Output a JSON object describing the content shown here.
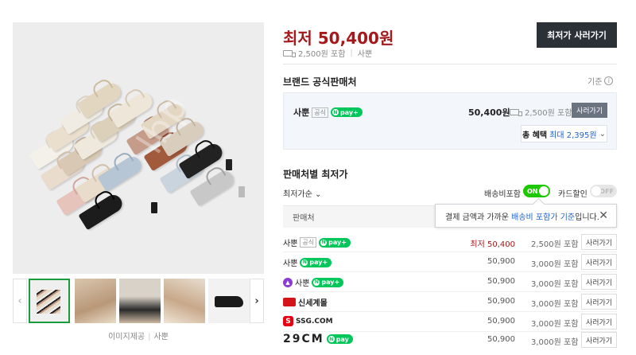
{
  "main_image": {
    "watermark": "lbp"
  },
  "gallery": {
    "prev": "‹",
    "next": "›",
    "caption_label": "이미지제공",
    "caption_sep": "|",
    "caption_source": "사뿐"
  },
  "summary": {
    "price": "최저 50,400원",
    "shipping": "2,500원 포함",
    "separator": "|",
    "store": "사뿐",
    "buy_button": "최저가 사러가기"
  },
  "official": {
    "title": "브랜드 공식판매처",
    "criteria": "기준",
    "seller": "사뿐",
    "badge": "공식",
    "pay_label": "pay+",
    "price": "50,400원",
    "shipping": "2,500원 포함",
    "go_button": "사러가기",
    "benefit_label": "총 혜택",
    "benefit_max": "최대 2,395원"
  },
  "sellers": {
    "title": "판매처별 최저가",
    "sort": "최저가순",
    "toggle1_label": "배송비포함",
    "toggle1_state": "ON",
    "toggle2_label": "카드할인",
    "toggle2_state": "OFF",
    "column_seller": "판매처",
    "tooltip_text": "결제 금액과 가까운",
    "tooltip_highlight": "배송비 포함가 기준",
    "tooltip_tail": "입니다.",
    "rows": [
      {
        "name": "사뿐",
        "badge": "공식",
        "pay": "pay+",
        "price": "최저 50,400",
        "shipping": "2,500원 포함",
        "button": "사러가기"
      },
      {
        "name": "사뿐",
        "pay": "pay+",
        "price": "50,900",
        "shipping": "3,000원 포함",
        "button": "사러가기"
      },
      {
        "name": "사뿐",
        "pay": "pay+",
        "price": "50,900",
        "shipping": "3,000원 포함",
        "button": "사러가기"
      },
      {
        "name": "신세계몰",
        "price": "50,900",
        "shipping": "3,000원 포함",
        "button": "사러가기"
      },
      {
        "name": "SSG.COM",
        "price": "50,900",
        "shipping": "3,000원 포함",
        "button": "사러가기"
      },
      {
        "name": "29CM",
        "pay": "pay",
        "price": "50,900",
        "shipping": "3,000원 포함",
        "button": "사러가기"
      }
    ]
  },
  "colors": {
    "price_red": "#a3191c",
    "naver_green": "#03c75a",
    "toggle_on": "#1ec800",
    "buy_button_bg": "#2c3138",
    "link_blue": "#2562c7"
  }
}
